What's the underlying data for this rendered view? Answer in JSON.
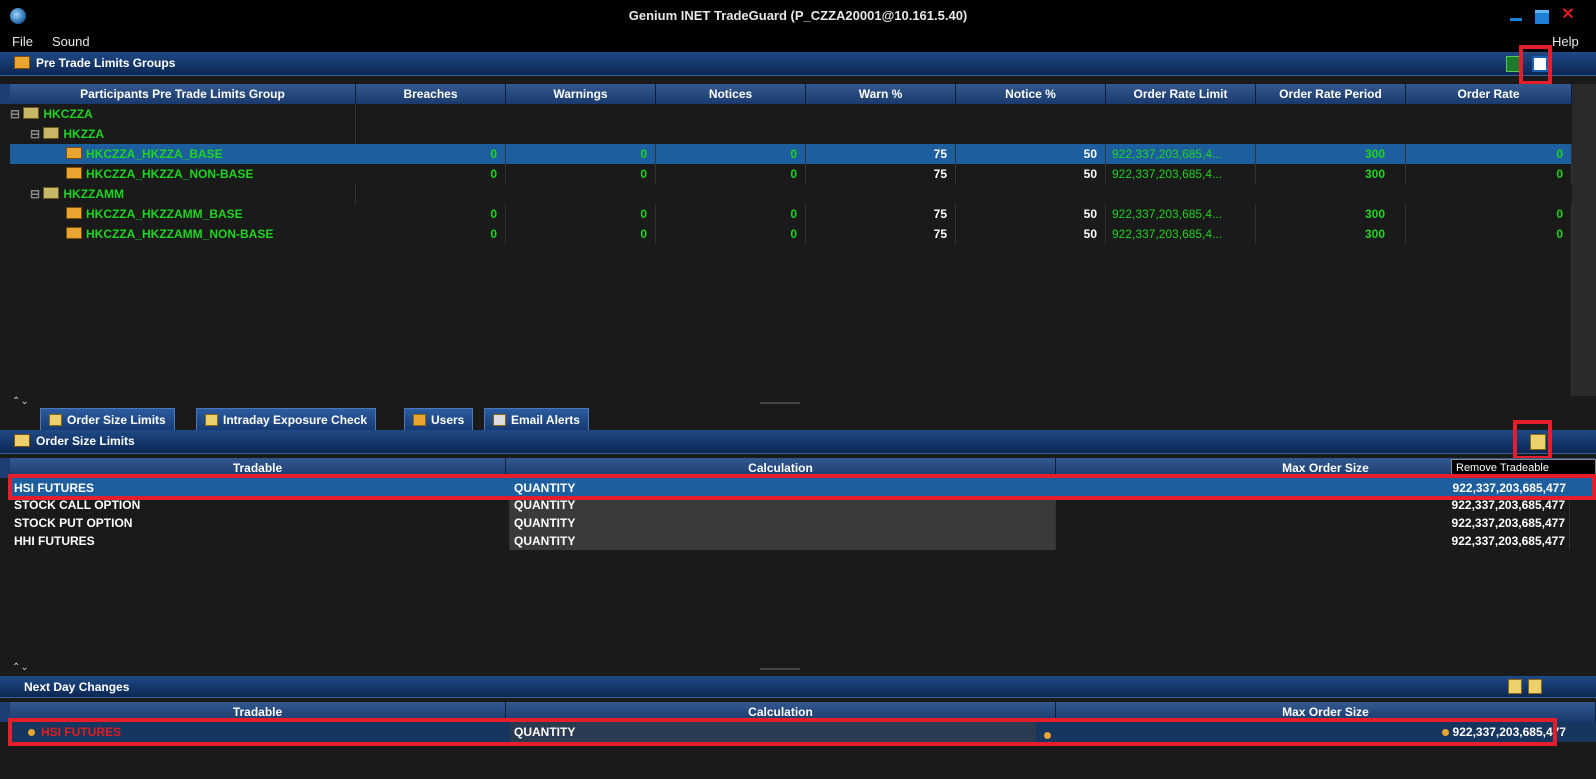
{
  "window": {
    "title": "Genium INET TradeGuard (P_CZZA20001@10.161.5.40)",
    "close_glyph": "✕"
  },
  "menu": {
    "file": "File",
    "sound": "Sound",
    "help": "Help"
  },
  "groups_panel": {
    "title": "Pre Trade Limits Groups",
    "columns": [
      "Participants Pre Trade Limits Group",
      "Breaches",
      "Warnings",
      "Notices",
      "Warn %",
      "Notice %",
      "Order Rate Limit",
      "Order Rate Period",
      "Order Rate"
    ],
    "rows": [
      {
        "label": "HKCZZA",
        "level": 0,
        "kind": "node"
      },
      {
        "label": "HKZZA",
        "level": 1,
        "kind": "node"
      },
      {
        "label": "HKCZZA_HKZZA_BASE",
        "level": 2,
        "kind": "leaf",
        "breaches": "0",
        "warnings": "0",
        "notices": "0",
        "warn_pct": "75",
        "notice_pct": "50",
        "order_rate_limit": "922,337,203,685,4...",
        "order_rate_period": "300",
        "order_rate": "0",
        "selected": true
      },
      {
        "label": "HKCZZA_HKZZA_NON-BASE",
        "level": 2,
        "kind": "leaf",
        "breaches": "0",
        "warnings": "0",
        "notices": "0",
        "warn_pct": "75",
        "notice_pct": "50",
        "order_rate_limit": "922,337,203,685,4...",
        "order_rate_period": "300",
        "order_rate": "0"
      },
      {
        "label": "HKZZAMM",
        "level": 1,
        "kind": "node"
      },
      {
        "label": "HKCZZA_HKZZAMM_BASE",
        "level": 2,
        "kind": "leaf",
        "breaches": "0",
        "warnings": "0",
        "notices": "0",
        "warn_pct": "75",
        "notice_pct": "50",
        "order_rate_limit": "922,337,203,685,4...",
        "order_rate_period": "300",
        "order_rate": "0"
      },
      {
        "label": "HKCZZA_HKZZAMM_NON-BASE",
        "level": 2,
        "kind": "leaf",
        "breaches": "0",
        "warnings": "0",
        "notices": "0",
        "warn_pct": "75",
        "notice_pct": "50",
        "order_rate_limit": "922,337,203,685,4...",
        "order_rate_period": "300",
        "order_rate": "0"
      }
    ]
  },
  "tabs": [
    "Order Size Limits",
    "Intraday Exposure Check",
    "Users",
    "Email Alerts"
  ],
  "order_size_panel": {
    "title": "Order Size Limits",
    "tooltip": "Remove Tradeable",
    "columns": [
      "Tradable",
      "Calculation",
      "Max Order Size"
    ],
    "rows": [
      {
        "tradable": "HSI FUTURES",
        "calculation": "QUANTITY",
        "max_order_size": "922,337,203,685,477",
        "selected": true
      },
      {
        "tradable": "STOCK CALL OPTION",
        "calculation": "QUANTITY",
        "max_order_size": "922,337,203,685,477"
      },
      {
        "tradable": "STOCK PUT OPTION",
        "calculation": "QUANTITY",
        "max_order_size": "922,337,203,685,477"
      },
      {
        "tradable": "HHI FUTURES",
        "calculation": "QUANTITY",
        "max_order_size": "922,337,203,685,477"
      }
    ]
  },
  "next_day_panel": {
    "title": "Next Day Changes",
    "columns": [
      "Tradable",
      "Calculation",
      "Max Order Size"
    ],
    "rows": [
      {
        "tradable": "HSI FUTURES",
        "calculation": "QUANTITY",
        "max_order_size": "922,337,203,685,477"
      }
    ]
  },
  "colors": {
    "highlight": "#e51e2b",
    "value_green": "#1fd41f",
    "header_blue": "#1e4a86"
  }
}
